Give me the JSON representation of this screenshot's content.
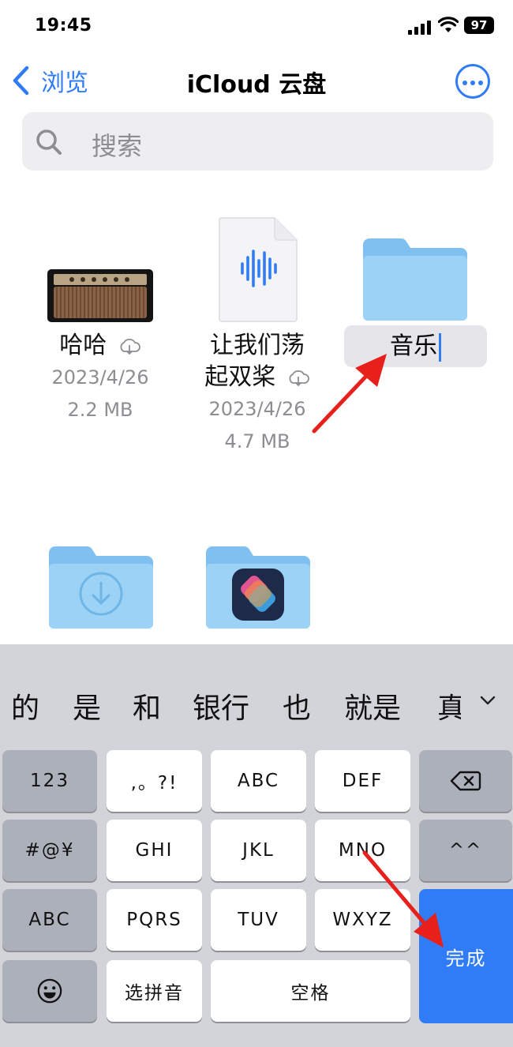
{
  "status_bar": {
    "time": "19:45",
    "battery": "97"
  },
  "nav": {
    "back_label": "浏览",
    "title": "iCloud 云盘"
  },
  "search": {
    "placeholder": "搜索"
  },
  "files": [
    {
      "name": "哈哈",
      "date": "2023/4/26",
      "size": "2.2 MB",
      "icon": "guitar-amp-thumbnail",
      "cloud": true
    },
    {
      "name_line1": "让我们荡",
      "name_line2": "起双桨",
      "date": "2023/4/26",
      "size": "4.7 MB",
      "icon": "audio-file-icon",
      "cloud": true
    },
    {
      "name": "音乐",
      "icon": "folder-icon",
      "editing": true
    }
  ],
  "folders_partial": [
    {
      "name": "下载",
      "icon": "download-folder-icon"
    },
    {
      "name": "Shortcuts",
      "icon": "shortcuts-folder-icon"
    }
  ],
  "keyboard": {
    "candidates": [
      "的",
      "是",
      "和",
      "银行",
      "也",
      "就是",
      "真"
    ],
    "keys": {
      "num": "123",
      "punct": ",。?!",
      "abc": "ABC",
      "def": "DEF",
      "symbols": "#@¥",
      "ghi": "GHI",
      "jkl": "JKL",
      "mno": "MNO",
      "emoticon": "^^",
      "abc_mode": "ABC",
      "pqrs": "PQRS",
      "tuv": "TUV",
      "wxyz": "WXYZ",
      "done": "完成",
      "select_pinyin": "选拼音",
      "space": "空格"
    }
  },
  "colors": {
    "accent": "#2f7cf6",
    "folder": "#8ecbf5",
    "annotation_arrow": "#e8201c",
    "keyboard_bg": "#d2d4da"
  }
}
